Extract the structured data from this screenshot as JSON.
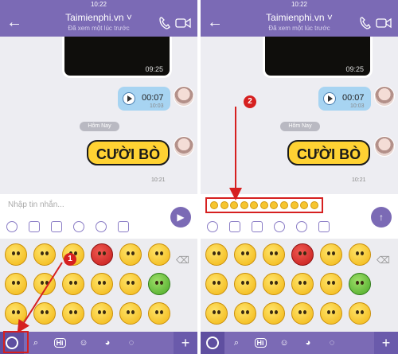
{
  "status": {
    "time": "10:22"
  },
  "header": {
    "title": "Taimienphi.vn ˅",
    "subtitle": "Đã xem một lúc trước"
  },
  "messages": {
    "video_duration": "09:25",
    "audio_duration": "00:07",
    "audio_time": "10:03",
    "date_separator": "Hôm Nay",
    "sticker_text": "CƯỜI BÒ",
    "sticker_time": "10:21"
  },
  "composer": {
    "placeholder": "Nhập tin nhắn..."
  },
  "bottom_bar": {
    "hi_label": "Hi",
    "plus_label": "+"
  },
  "markers": {
    "one": "1",
    "two": "2"
  },
  "colors": {
    "brand": "#7b6ab5",
    "annotation": "#d62020"
  },
  "emoji_colors": [
    "yellow",
    "yellow",
    "yellow",
    "red",
    "yellow",
    "yellow",
    "yellow",
    "yellow",
    "yellow",
    "yellow",
    "yellow",
    "green",
    "yellow",
    "yellow",
    "yellow",
    "yellow",
    "yellow",
    "yellow"
  ]
}
